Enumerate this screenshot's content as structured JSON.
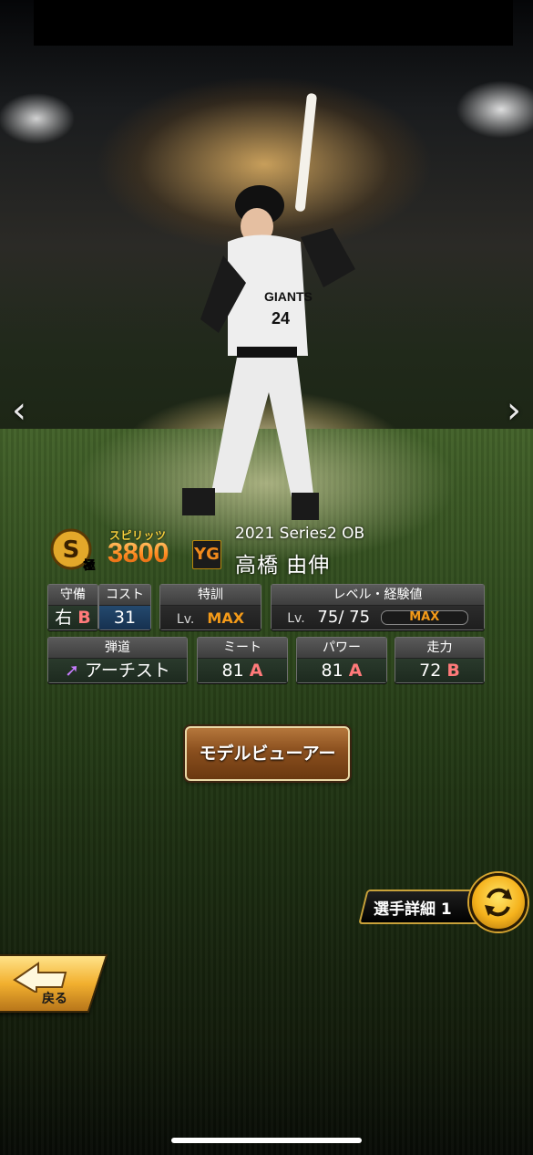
{
  "nav": {
    "prev": "‹",
    "next": "›"
  },
  "card": {
    "spirits_label": "スピリッツ",
    "spirits_value": "3800",
    "rank_letter": "S",
    "rank_sub": "極",
    "team_logo": "YG",
    "series": "2021 Series2 OB",
    "name": "高橋 由伸",
    "uniform_text": "GIANTS",
    "uniform_number": "24"
  },
  "stats": {
    "position": {
      "label": "守備",
      "value": "右",
      "grade": "B"
    },
    "cost": {
      "label": "コスト",
      "value": "31"
    },
    "training": {
      "label": "特訓",
      "lv_prefix": "Lv.",
      "value": "MAX"
    },
    "level": {
      "label": "レベル・経験値",
      "lv_prefix": "Lv.",
      "current": "75",
      "separator": "/",
      "max": "75",
      "bar_label": "MAX"
    },
    "trajectory": {
      "label": "弾道",
      "value": "アーチスト"
    },
    "meet": {
      "label": "ミート",
      "value": "81",
      "grade": "A"
    },
    "power": {
      "label": "パワー",
      "value": "81",
      "grade": "A"
    },
    "speed": {
      "label": "走力",
      "value": "72",
      "grade": "B"
    }
  },
  "buttons": {
    "model_viewer": "モデルビューアー",
    "player_detail": "選手詳細 1",
    "back": "戻る"
  },
  "colors": {
    "accent_orange": "#f39a19",
    "grade_red": "#ff7a7a",
    "gold": "#c9a23a"
  }
}
